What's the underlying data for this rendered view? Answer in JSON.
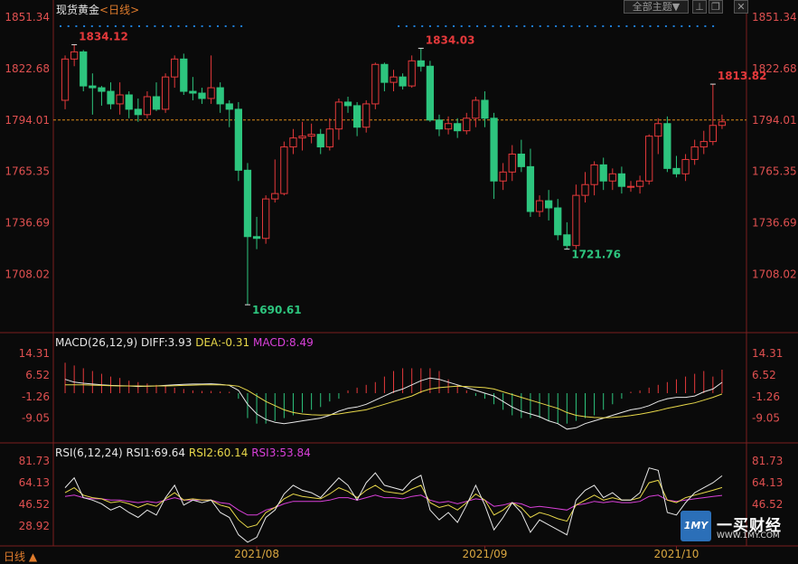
{
  "header": {
    "title": "现货黄金",
    "period_bracket": "<日线>",
    "theme_button": "全部主题▼",
    "icon_names": [
      "pin-icon",
      "restore-icon",
      "close-icon"
    ]
  },
  "chart_data": [
    {
      "type": "candlestick",
      "title": "现货黄金 <日线>",
      "y_ticks": [
        1851.34,
        1822.68,
        1794.01,
        1765.35,
        1736.69,
        1708.02
      ],
      "ylim": [
        1680,
        1851.34
      ],
      "ref_line": 1794.01,
      "x_labels": [
        "2021/08",
        "2021/09",
        "2021/10"
      ],
      "annotations": [
        {
          "text": "1834.12",
          "kind": "high"
        },
        {
          "text": "1690.61",
          "kind": "low"
        },
        {
          "text": "1834.03",
          "kind": "high"
        },
        {
          "text": "1721.76",
          "kind": "low"
        },
        {
          "text": "1813.82",
          "kind": "high"
        }
      ],
      "candles": [
        [
          1805,
          1830,
          1800,
          1828
        ],
        [
          1828,
          1836,
          1824,
          1832
        ],
        [
          1832,
          1833,
          1810,
          1813
        ],
        [
          1813,
          1820,
          1797,
          1812
        ],
        [
          1812,
          1813,
          1802,
          1810
        ],
        [
          1810,
          1815,
          1800,
          1803
        ],
        [
          1803,
          1815,
          1797,
          1808
        ],
        [
          1808,
          1810,
          1795,
          1800
        ],
        [
          1800,
          1806,
          1793,
          1797
        ],
        [
          1797,
          1810,
          1795,
          1807
        ],
        [
          1807,
          1815,
          1799,
          1800
        ],
        [
          1800,
          1820,
          1798,
          1818
        ],
        [
          1818,
          1830,
          1812,
          1828
        ],
        [
          1828,
          1831,
          1808,
          1810
        ],
        [
          1810,
          1818,
          1805,
          1809
        ],
        [
          1809,
          1812,
          1803,
          1806
        ],
        [
          1806,
          1830,
          1803,
          1812
        ],
        [
          1812,
          1815,
          1798,
          1803
        ],
        [
          1803,
          1805,
          1790,
          1800
        ],
        [
          1800,
          1804,
          1760,
          1766
        ],
        [
          1766,
          1770,
          1691,
          1729
        ],
        [
          1729,
          1740,
          1722,
          1728
        ],
        [
          1728,
          1752,
          1725,
          1750
        ],
        [
          1750,
          1772,
          1748,
          1753
        ],
        [
          1753,
          1782,
          1752,
          1779
        ],
        [
          1779,
          1789,
          1775,
          1784
        ],
        [
          1784,
          1793,
          1777,
          1785
        ],
        [
          1785,
          1792,
          1781,
          1786
        ],
        [
          1786,
          1789,
          1775,
          1779
        ],
        [
          1779,
          1795,
          1777,
          1789
        ],
        [
          1789,
          1806,
          1783,
          1804
        ],
        [
          1804,
          1807,
          1798,
          1802
        ],
        [
          1802,
          1804,
          1785,
          1790
        ],
        [
          1790,
          1805,
          1787,
          1803
        ],
        [
          1803,
          1826,
          1800,
          1825
        ],
        [
          1825,
          1826,
          1810,
          1815
        ],
        [
          1815,
          1822,
          1810,
          1818
        ],
        [
          1818,
          1820,
          1811,
          1813
        ],
        [
          1813,
          1830,
          1812,
          1827
        ],
        [
          1827,
          1834,
          1821,
          1824
        ],
        [
          1824,
          1827,
          1793,
          1794
        ],
        [
          1794,
          1797,
          1785,
          1789
        ],
        [
          1789,
          1796,
          1786,
          1792
        ],
        [
          1792,
          1795,
          1784,
          1788
        ],
        [
          1788,
          1798,
          1786,
          1795
        ],
        [
          1795,
          1807,
          1790,
          1805
        ],
        [
          1805,
          1810,
          1790,
          1795
        ],
        [
          1795,
          1798,
          1750,
          1760
        ],
        [
          1760,
          1770,
          1755,
          1765
        ],
        [
          1765,
          1780,
          1760,
          1775
        ],
        [
          1775,
          1783,
          1765,
          1768
        ],
        [
          1768,
          1778,
          1740,
          1743
        ],
        [
          1743,
          1752,
          1740,
          1749
        ],
        [
          1749,
          1755,
          1738,
          1745
        ],
        [
          1745,
          1750,
          1727,
          1730
        ],
        [
          1730,
          1737,
          1722,
          1724
        ],
        [
          1724,
          1758,
          1722,
          1752
        ],
        [
          1752,
          1765,
          1748,
          1758
        ],
        [
          1758,
          1771,
          1752,
          1769
        ],
        [
          1769,
          1773,
          1755,
          1760
        ],
        [
          1760,
          1767,
          1755,
          1764
        ],
        [
          1764,
          1768,
          1753,
          1757
        ],
        [
          1757,
          1760,
          1754,
          1757
        ],
        [
          1757,
          1763,
          1753,
          1760
        ],
        [
          1760,
          1786,
          1758,
          1785
        ],
        [
          1785,
          1795,
          1775,
          1792
        ],
        [
          1792,
          1796,
          1765,
          1767
        ],
        [
          1767,
          1774,
          1762,
          1764
        ],
        [
          1764,
          1775,
          1760,
          1772
        ],
        [
          1772,
          1783,
          1769,
          1779
        ],
        [
          1779,
          1788,
          1775,
          1782
        ],
        [
          1782,
          1814,
          1780,
          1791
        ],
        [
          1791,
          1797,
          1789,
          1793
        ]
      ]
    },
    {
      "type": "macd",
      "title": "MACD(26,12,9)",
      "legend": [
        {
          "name": "DIFF",
          "value": "3.93",
          "color": "#e8e8e8"
        },
        {
          "name": "DEA",
          "value": "-0.31",
          "color": "#e8d84a"
        },
        {
          "name": "MACD",
          "value": "8.49",
          "color": "#d940d9"
        }
      ],
      "y_ticks": [
        14.31,
        6.52,
        -1.26,
        -9.05
      ],
      "ylim": [
        -16,
        16
      ],
      "diff": [
        5,
        4,
        3.6,
        3.3,
        3,
        2.8,
        2.7,
        2.6,
        2.4,
        2.5,
        2.6,
        2.8,
        3,
        3.2,
        3.3,
        3.3,
        3.4,
        3.2,
        2.8,
        1,
        -4,
        -7.5,
        -9.5,
        -10.5,
        -11,
        -10.5,
        -10,
        -9.5,
        -9,
        -8,
        -6.5,
        -5.5,
        -5,
        -4,
        -2.5,
        -1,
        0.5,
        1.5,
        3,
        4.5,
        5.5,
        5,
        4,
        3,
        2,
        1,
        0,
        -1,
        -3,
        -5,
        -6.5,
        -7.5,
        -8.5,
        -10,
        -11,
        -13,
        -12.5,
        -11,
        -10,
        -9,
        -8,
        -7,
        -6,
        -5.5,
        -4.5,
        -3,
        -2,
        -1.5,
        -1.5,
        -1,
        0.5,
        1.5,
        3.93
      ],
      "dea": [
        3,
        3,
        3,
        2.9,
        2.8,
        2.7,
        2.6,
        2.6,
        2.6,
        2.5,
        2.6,
        2.6,
        2.7,
        2.8,
        2.9,
        3,
        3,
        3,
        2.9,
        2.5,
        1,
        -1,
        -3,
        -4.5,
        -6,
        -7,
        -7.5,
        -7.8,
        -7.9,
        -7.8,
        -7.5,
        -7,
        -6.5,
        -6,
        -5,
        -4,
        -3,
        -2,
        -1,
        0.5,
        1.5,
        2,
        2.3,
        2.5,
        2.4,
        2.2,
        2,
        1.5,
        0.5,
        -0.5,
        -1.5,
        -2.5,
        -3.5,
        -4.5,
        -5.5,
        -7,
        -8,
        -8.5,
        -8.8,
        -8.9,
        -8.8,
        -8.5,
        -8.1,
        -7.6,
        -7,
        -6.3,
        -5.5,
        -4.8,
        -4.1,
        -3.5,
        -2.5,
        -1.5,
        -0.31
      ],
      "hist": [
        11,
        10,
        9,
        8,
        7,
        6,
        5.5,
        4.5,
        4,
        3.5,
        3,
        2.5,
        2,
        1.5,
        1,
        0.8,
        0.8,
        0.6,
        0.5,
        -2,
        -9,
        -11,
        -11,
        -10,
        -9,
        -8,
        -7,
        -6,
        -5,
        -3,
        -2,
        1,
        2,
        3,
        4,
        6,
        8,
        9,
        9,
        9,
        9,
        8,
        5,
        3,
        1,
        -1,
        -2,
        -4,
        -6,
        -8,
        -9,
        -9,
        -9,
        -10,
        -11,
        -11,
        -10,
        -9,
        -8,
        -6,
        -4,
        -2,
        0.5,
        1,
        2,
        3,
        4,
        5,
        6,
        7,
        8,
        6,
        8.49
      ]
    },
    {
      "type": "rsi",
      "title": "RSI(6,12,24)",
      "legend": [
        {
          "name": "RSI1",
          "value": "69.64",
          "color": "#e8e8e8"
        },
        {
          "name": "RSI2",
          "value": "60.14",
          "color": "#e8d84a"
        },
        {
          "name": "RSI3",
          "value": "53.84",
          "color": "#d940d9"
        }
      ],
      "y_ticks": [
        81.73,
        64.13,
        46.52,
        28.92
      ],
      "ylim": [
        13,
        86
      ],
      "rsi1": [
        60,
        68,
        52,
        50,
        47,
        42,
        45,
        40,
        36,
        42,
        38,
        52,
        62,
        46,
        50,
        48,
        50,
        40,
        36,
        22,
        16,
        20,
        36,
        42,
        55,
        62,
        58,
        56,
        52,
        60,
        68,
        62,
        50,
        64,
        72,
        62,
        60,
        58,
        66,
        70,
        42,
        34,
        40,
        32,
        46,
        62,
        46,
        26,
        36,
        48,
        40,
        24,
        34,
        30,
        26,
        22,
        50,
        58,
        62,
        52,
        56,
        50,
        50,
        56,
        76,
        74,
        40,
        38,
        48,
        56,
        60,
        64,
        69.64
      ],
      "rsi2": [
        56,
        60,
        54,
        52,
        51,
        48,
        49,
        47,
        44,
        47,
        45,
        51,
        56,
        50,
        51,
        50,
        50,
        46,
        44,
        34,
        28,
        30,
        40,
        44,
        51,
        55,
        53,
        52,
        51,
        55,
        60,
        57,
        52,
        58,
        62,
        57,
        56,
        55,
        59,
        62,
        48,
        44,
        46,
        42,
        48,
        55,
        50,
        38,
        42,
        48,
        44,
        36,
        40,
        38,
        35,
        33,
        46,
        50,
        54,
        50,
        52,
        50,
        50,
        52,
        64,
        66,
        50,
        48,
        52,
        54,
        56,
        58,
        60.14
      ],
      "rsi3": [
        53,
        54,
        52,
        51,
        51,
        50,
        50,
        49,
        48,
        49,
        48,
        50,
        52,
        50,
        50,
        50,
        50,
        48,
        47,
        42,
        38,
        38,
        42,
        44,
        47,
        49,
        49,
        49,
        49,
        50,
        52,
        52,
        50,
        52,
        54,
        52,
        52,
        51,
        53,
        54,
        50,
        48,
        49,
        47,
        49,
        51,
        50,
        45,
        46,
        48,
        47,
        44,
        45,
        44,
        43,
        42,
        46,
        47,
        49,
        48,
        49,
        48,
        48,
        49,
        53,
        54,
        50,
        49,
        50,
        51,
        52,
        53,
        53.84
      ]
    }
  ],
  "footer": {
    "period_button": "日线 ▲",
    "months": [
      "2021/08",
      "2021/09",
      "2021/10"
    ]
  },
  "watermark": {
    "logo_text": "1MY",
    "name": "一买财经",
    "url": "WWW.1MY.COM"
  },
  "colors": {
    "up": "#e5393b",
    "down": "#2dc57e",
    "axis_text": "#e05050",
    "dots": "#1e7ed6",
    "ref_line": "#d98b19"
  }
}
